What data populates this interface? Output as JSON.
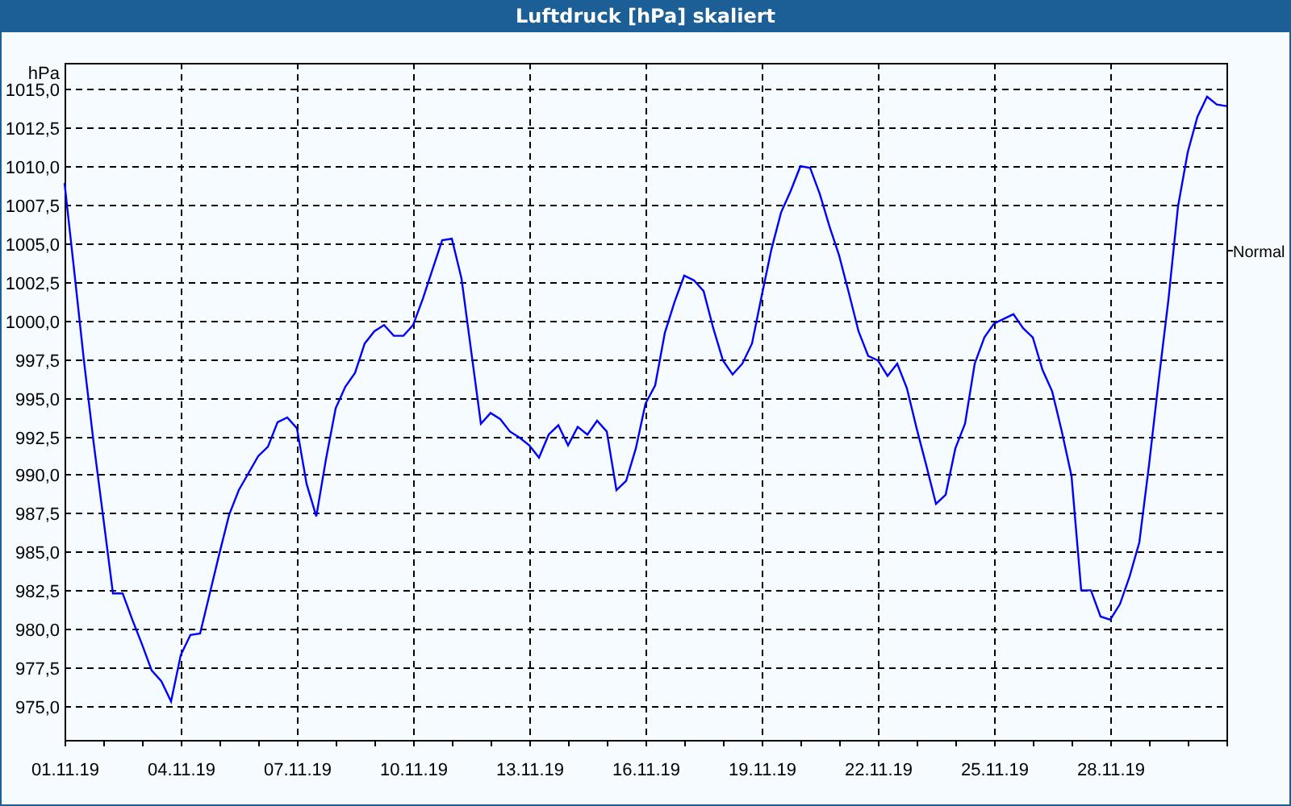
{
  "window": {
    "title": "Luftdruck [hPa] skaliert"
  },
  "chart": {
    "chart_data": {
      "type": "line",
      "grid": true,
      "ylabel": "hPa",
      "ylim": [
        972.8,
        1016.7
      ],
      "yticks": [
        {
          "value": 975,
          "label": "975,0"
        },
        {
          "value": 977.5,
          "label": "977,5"
        },
        {
          "value": 980,
          "label": "980,0"
        },
        {
          "value": 982.5,
          "label": "982,5"
        },
        {
          "value": 985,
          "label": "985,0"
        },
        {
          "value": 987.5,
          "label": "987,5"
        },
        {
          "value": 990,
          "label": "990,0"
        },
        {
          "value": 992.5,
          "label": "992,5"
        },
        {
          "value": 995,
          "label": "995,0"
        },
        {
          "value": 997.5,
          "label": "997,5"
        },
        {
          "value": 1000,
          "label": "1000,0"
        },
        {
          "value": 1002.5,
          "label": "1002,5"
        },
        {
          "value": 1005,
          "label": "1005,0"
        },
        {
          "value": 1007.5,
          "label": "1007,5"
        },
        {
          "value": 1010,
          "label": "1010,0"
        },
        {
          "value": 1012.5,
          "label": "1012,5"
        },
        {
          "value": 1015,
          "label": "1015,0"
        }
      ],
      "ref_lines": [
        {
          "axis": "y",
          "value": 1004.6,
          "label": "Normal"
        }
      ],
      "categories": [
        "01.11.19",
        null,
        null,
        null,
        null,
        null,
        null,
        null,
        null,
        null,
        null,
        null,
        "04.11.19",
        null,
        null,
        null,
        null,
        null,
        null,
        null,
        null,
        null,
        null,
        null,
        "07.11.19",
        null,
        null,
        null,
        null,
        null,
        null,
        null,
        null,
        null,
        null,
        null,
        "10.11.19",
        null,
        null,
        null,
        null,
        null,
        null,
        null,
        null,
        null,
        null,
        null,
        "13.11.19",
        null,
        null,
        null,
        null,
        null,
        null,
        null,
        null,
        null,
        null,
        null,
        "16.11.19",
        null,
        null,
        null,
        null,
        null,
        null,
        null,
        null,
        null,
        null,
        null,
        "19.11.19",
        null,
        null,
        null,
        null,
        null,
        null,
        null,
        null,
        null,
        null,
        null,
        "22.11.19",
        null,
        null,
        null,
        null,
        null,
        null,
        null,
        null,
        null,
        null,
        null,
        "25.11.19",
        null,
        null,
        null,
        null,
        null,
        null,
        null,
        null,
        null,
        null,
        null,
        "28.11.19",
        null,
        null,
        null,
        null,
        null,
        null,
        null,
        null,
        null,
        null,
        null,
        null
      ],
      "series": [
        {
          "color": "#0000ff",
          "values": [
            1008.9,
            1003.2,
            997.4,
            992.1,
            987.2,
            982.3,
            982.3,
            980.6,
            979.0,
            977.3,
            976.6,
            975.3,
            978.3,
            979.6,
            979.7,
            982.3,
            984.9,
            987.4,
            989.0,
            990.1,
            991.2,
            991.8,
            993.4,
            993.7,
            993.0,
            989.4,
            987.3,
            991.0,
            994.3,
            995.7,
            996.6,
            998.5,
            999.3,
            999.7,
            999.0,
            999.0,
            999.7,
            1001.4,
            1003.3,
            1005.2,
            1005.3,
            1002.7,
            998.0,
            993.3,
            994.0,
            993.6,
            992.8,
            992.4,
            991.9,
            991.1,
            992.6,
            993.2,
            991.9,
            993.1,
            992.6,
            993.5,
            992.8,
            989.0,
            989.6,
            991.7,
            994.6,
            995.8,
            999.2,
            1001.2,
            1002.9,
            1002.6,
            1001.9,
            999.5,
            997.4,
            996.5,
            997.2,
            998.5,
            1001.6,
            1004.6,
            1007.0,
            1008.4,
            1010.0,
            1009.9,
            1008.2,
            1006.1,
            1004.2,
            1001.8,
            999.3,
            997.7,
            997.4,
            996.4,
            997.2,
            995.6,
            993.0,
            990.6,
            988.1,
            988.7,
            991.7,
            993.3,
            997.2,
            998.9,
            999.8,
            1000.1,
            1000.4,
            999.5,
            998.9,
            996.8,
            995.4,
            992.8,
            989.9,
            982.5,
            982.5,
            980.8,
            980.6,
            981.6,
            983.4,
            985.6,
            990.6,
            996.1,
            1001.3,
            1007.4,
            1010.9,
            1013.2,
            1014.5,
            1014.0,
            1013.9
          ]
        }
      ]
    }
  }
}
